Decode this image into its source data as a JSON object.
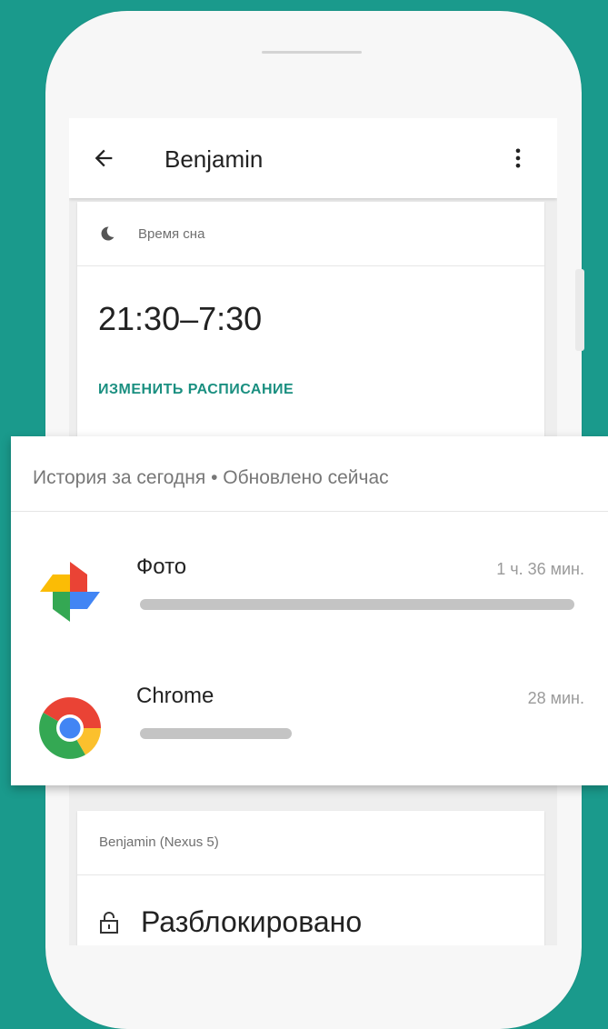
{
  "appbar": {
    "title": "Benjamin"
  },
  "sleep": {
    "label": "Время сна",
    "time": "21:30–7:30",
    "action": "ИЗМЕНИТЬ РАСПИСАНИЕ"
  },
  "history": {
    "header": "История за сегодня • Обновлено сейчас",
    "apps": [
      {
        "name": "Фото",
        "duration": "1 ч. 36 мин.",
        "icon": "google-photos-icon",
        "usage_fraction": 1.0
      },
      {
        "name": "Chrome",
        "duration": "28 мин.",
        "icon": "chrome-icon",
        "usage_fraction": 0.35
      }
    ]
  },
  "device": {
    "label": "Benjamin (Nexus 5)",
    "status": "Разблокировано",
    "icon": "lock-icon"
  },
  "colors": {
    "background": "#1a9a8c",
    "accent": "#1a8f80"
  }
}
